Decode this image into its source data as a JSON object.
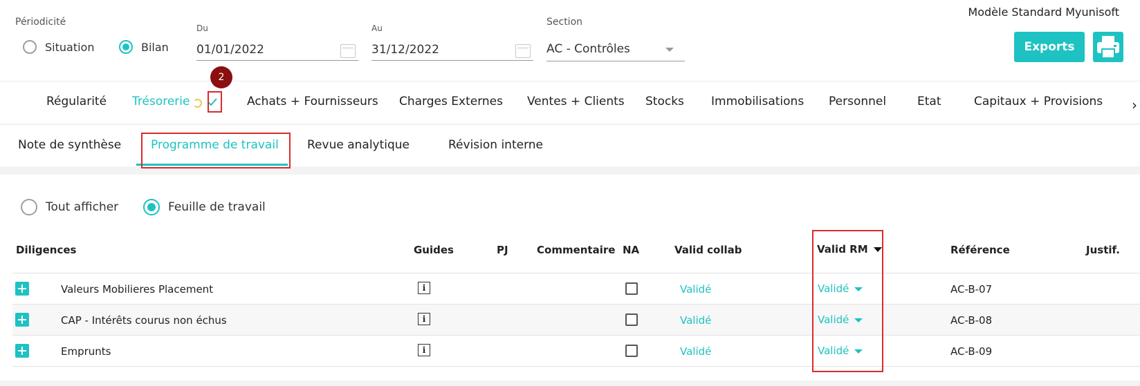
{
  "filters": {
    "periodicite_label": "Périodicité",
    "options": [
      {
        "label": "Situation",
        "selected": false
      },
      {
        "label": "Bilan",
        "selected": true
      }
    ],
    "du_label": "Du",
    "du_value": "01/01/2022",
    "au_label": "Au",
    "au_value": "31/12/2022",
    "section_label": "Section",
    "section_value": "AC - Contrôles"
  },
  "header": {
    "model_name": "Modèle Standard Myunisoft",
    "exports_label": "Exports"
  },
  "main_tabs": {
    "items": [
      "Régularité",
      "Trésorerie",
      "Achats + Fournisseurs",
      "Charges Externes",
      "Ventes + Clients",
      "Stocks",
      "Immobilisations",
      "Personnel",
      "Etat",
      "Capitaux + Provisions"
    ],
    "active": "Trésorerie",
    "badge": "2",
    "more_arrow": "›"
  },
  "sub_tabs": {
    "items": [
      "Note de synthèse",
      "Programme de travail",
      "Revue analytique",
      "Révision interne"
    ],
    "active": "Programme de travail"
  },
  "view_toggle": {
    "options": [
      {
        "label": "Tout afficher",
        "selected": false
      },
      {
        "label": "Feuille de travail",
        "selected": true
      }
    ]
  },
  "table": {
    "columns": [
      "Diligences",
      "Guides",
      "PJ",
      "Commentaire",
      "NA",
      "Valid collab",
      "Valid RM",
      "Référence",
      "Justif."
    ],
    "rows": [
      {
        "diligence": "Valeurs Mobilieres Placement",
        "guide": "i",
        "na": false,
        "valid_collab": "Validé",
        "valid_rm": "Validé",
        "reference": "AC-B-07"
      },
      {
        "diligence": "CAP - Intérêts courus non échus",
        "guide": "i",
        "na": false,
        "valid_collab": "Validé",
        "valid_rm": "Validé",
        "reference": "AC-B-08"
      },
      {
        "diligence": "Emprunts",
        "guide": "i",
        "na": false,
        "valid_collab": "Validé",
        "valid_rm": "Validé",
        "reference": "AC-B-09"
      }
    ]
  },
  "colors": {
    "accent": "#1ec2c2",
    "highlight_box": "#d92b2b",
    "badge": "#8b0f0f"
  }
}
